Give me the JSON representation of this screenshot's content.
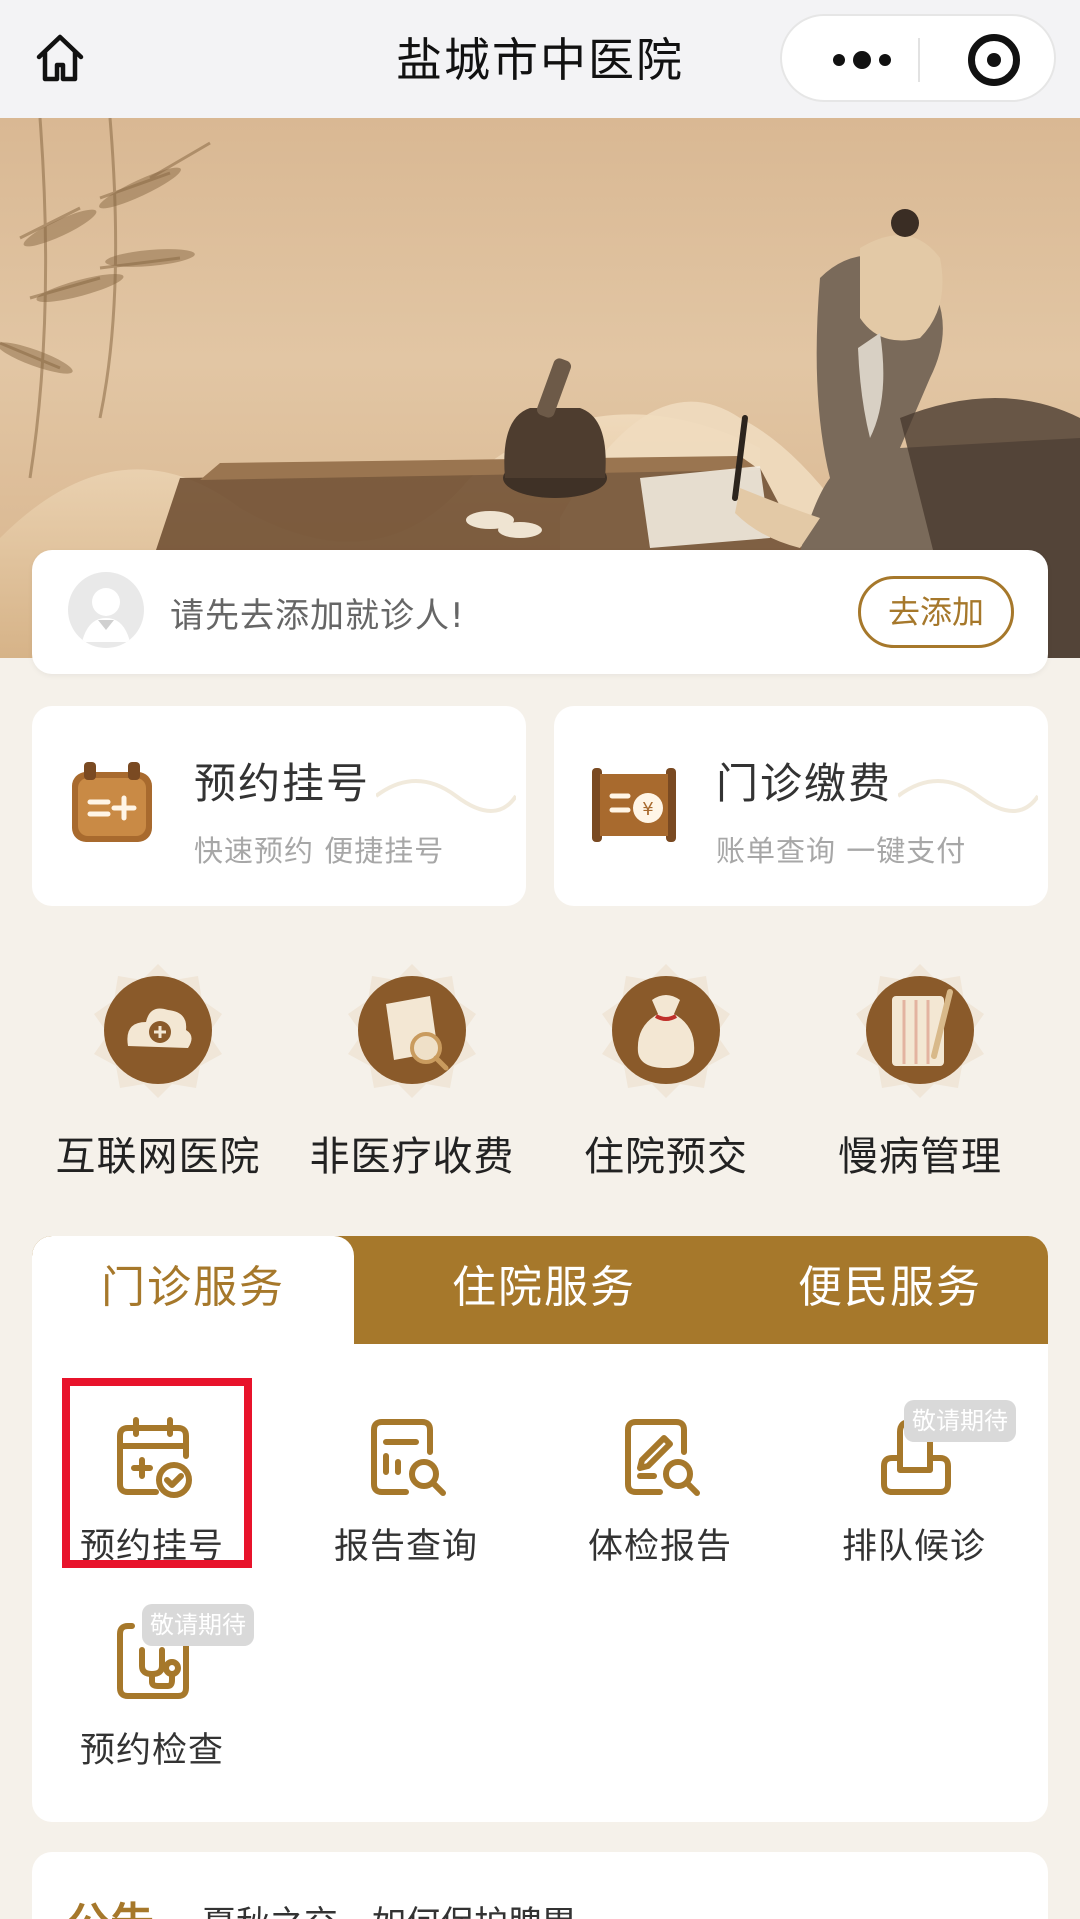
{
  "topbar": {
    "title": "盐城市中医院",
    "home_icon": "home-icon",
    "more_icon": "more-dots-icon",
    "close_icon": "target-icon"
  },
  "banner": {
    "description_icon": "tcm-doctor-illustration"
  },
  "patient": {
    "prompt": "请先去添加就诊人!",
    "add_label": "去添加"
  },
  "quick_cards": [
    {
      "title": "预约挂号",
      "subtitle": "快速预约 便捷挂号",
      "icon": "register-icon"
    },
    {
      "title": "门诊缴费",
      "subtitle": "账单查询 一键支付",
      "icon": "payment-icon"
    }
  ],
  "round_items": [
    {
      "label": "互联网医院",
      "icon": "cloud-plus-icon"
    },
    {
      "label": "非医疗收费",
      "icon": "scroll-search-icon"
    },
    {
      "label": "住院预交",
      "icon": "money-bag-icon"
    },
    {
      "label": "慢病管理",
      "icon": "notebook-brush-icon"
    }
  ],
  "tabs": [
    {
      "label": "门诊服务",
      "active": true
    },
    {
      "label": "住院服务",
      "active": false
    },
    {
      "label": "便民服务",
      "active": false
    }
  ],
  "services": [
    {
      "label": "预约挂号",
      "icon": "calendar-check-icon",
      "badge": ""
    },
    {
      "label": "报告查询",
      "icon": "report-search-icon",
      "badge": ""
    },
    {
      "label": "体检报告",
      "icon": "exam-report-icon",
      "badge": ""
    },
    {
      "label": "排队候诊",
      "icon": "queue-icon",
      "badge": "敬请期待"
    },
    {
      "label": "预约检查",
      "icon": "stethoscope-icon",
      "badge": "敬请期待"
    }
  ],
  "notice": {
    "tag": "公告",
    "text": "夏秋之交，如何保护脾胃"
  },
  "colors": {
    "brand": "#a6782b",
    "highlight": "#e8132b",
    "background": "#f5f1ea"
  }
}
